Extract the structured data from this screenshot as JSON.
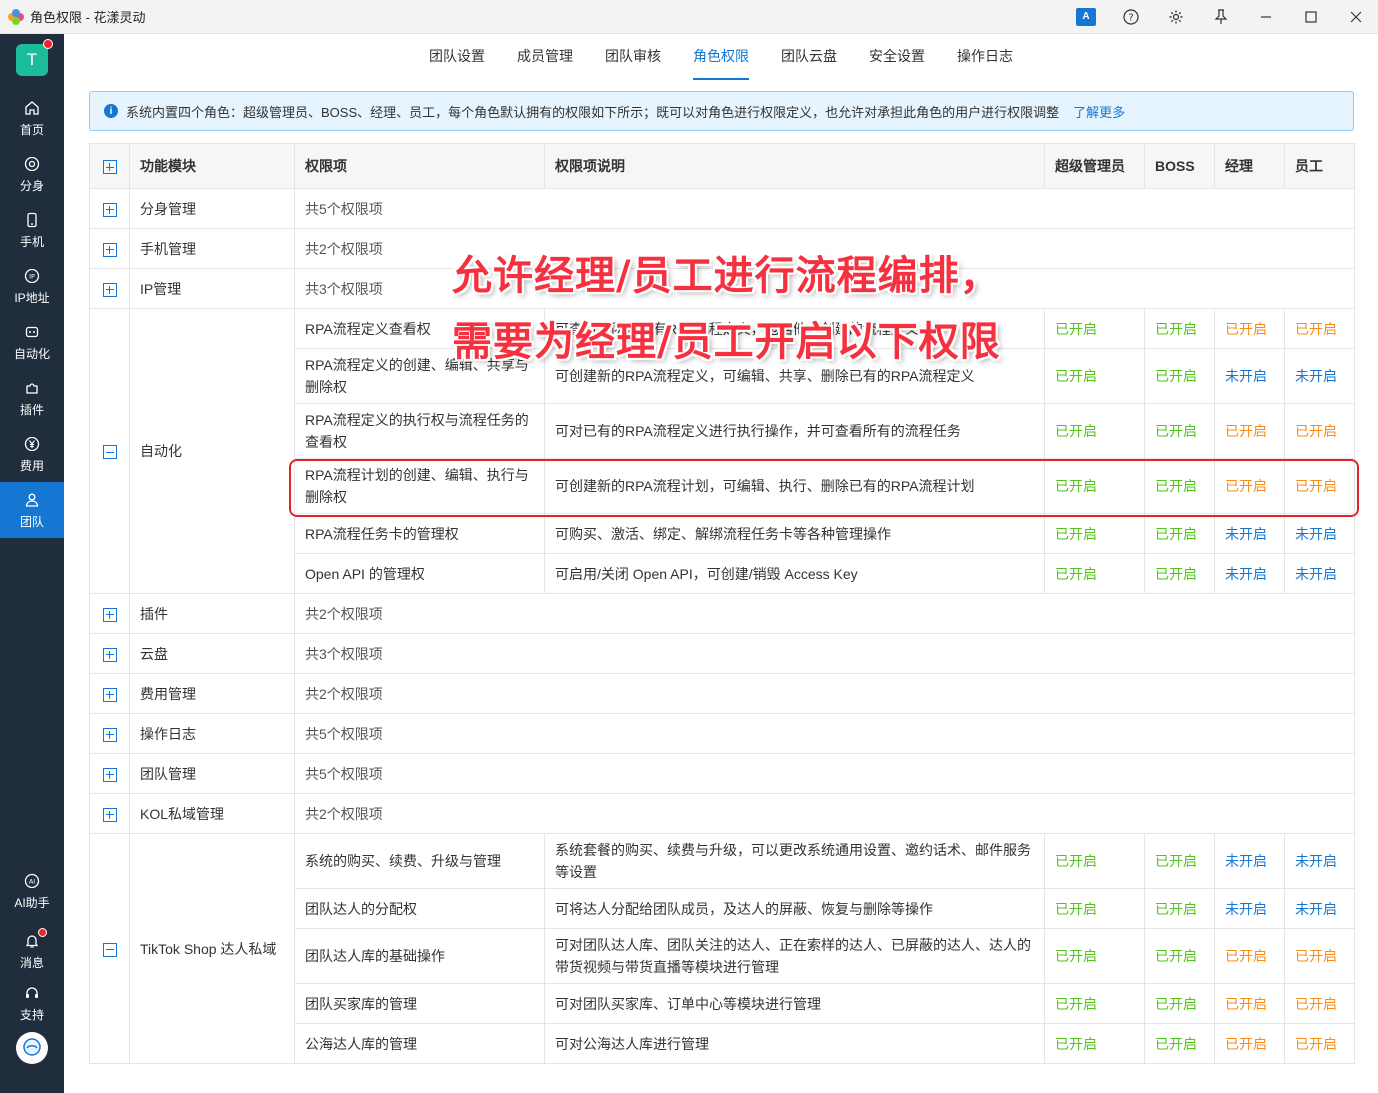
{
  "window": {
    "title": "角色权限 - 花漾灵动",
    "translate_label": "A",
    "help_icon": "help-circle-icon",
    "settings_icon": "gear-icon",
    "pin_icon": "pin-icon",
    "minimize_icon": "minimize-icon",
    "maximize_icon": "maximize-icon",
    "close_icon": "close-icon"
  },
  "sidebar": {
    "avatar_letter": "T",
    "items": [
      {
        "label": "首页",
        "icon": "home-icon"
      },
      {
        "label": "分身",
        "icon": "browser-icon"
      },
      {
        "label": "手机",
        "icon": "phone-icon"
      },
      {
        "label": "IP地址",
        "icon": "ip-icon"
      },
      {
        "label": "自动化",
        "icon": "robot-icon"
      },
      {
        "label": "插件",
        "icon": "puzzle-icon"
      },
      {
        "label": "费用",
        "icon": "yen-icon"
      },
      {
        "label": "团队",
        "icon": "team-icon"
      }
    ],
    "bottom_items": [
      {
        "label": "AI助手",
        "icon": "ai-icon"
      },
      {
        "label": "消息",
        "icon": "bell-icon"
      },
      {
        "label": "支持",
        "icon": "headset-icon"
      }
    ]
  },
  "tabs": [
    "团队设置",
    "成员管理",
    "团队审核",
    "角色权限",
    "团队云盘",
    "安全设置",
    "操作日志"
  ],
  "active_tab": 3,
  "banner": {
    "text": "系统内置四个角色：超级管理员、BOSS、经理、员工，每个角色默认拥有的权限如下所示；既可以对角色进行权限定义，也允许对承担此角色的用户进行权限调整",
    "link": "了解更多"
  },
  "table": {
    "headers": [
      "功能模块",
      "权限项",
      "权限项说明",
      "超级管理员",
      "BOSS",
      "经理",
      "员工"
    ],
    "collapsed_top": [
      {
        "module": "分身管理",
        "summary": "共5个权限项"
      },
      {
        "module": "手机管理",
        "summary": "共2个权限项"
      },
      {
        "module": "IP管理",
        "summary": "共3个权限项"
      }
    ],
    "automation": {
      "module": "自动化",
      "rows": [
        {
          "item": "RPA流程定义查看权",
          "desc": "可查看团队内所有RPA流程定义，包括他人创建的流程定义",
          "s": [
            "已开启",
            "已开启",
            "已开启",
            "已开启"
          ],
          "c": [
            "on",
            "on",
            "warn",
            "warn"
          ]
        },
        {
          "item": "RPA流程定义的创建、编辑、共享与删除权",
          "desc": "可创建新的RPA流程定义，可编辑、共享、删除已有的RPA流程定义",
          "s": [
            "已开启",
            "已开启",
            "未开启",
            "未开启"
          ],
          "c": [
            "on",
            "on",
            "off",
            "off"
          ]
        },
        {
          "item": "RPA流程定义的执行权与流程任务的查看权",
          "desc": "可对已有的RPA流程定义进行执行操作，并可查看所有的流程任务",
          "s": [
            "已开启",
            "已开启",
            "已开启",
            "已开启"
          ],
          "c": [
            "on",
            "on",
            "warn",
            "warn"
          ]
        },
        {
          "item": "RPA流程计划的创建、编辑、执行与删除权",
          "desc": "可创建新的RPA流程计划，可编辑、执行、删除已有的RPA流程计划",
          "s": [
            "已开启",
            "已开启",
            "已开启",
            "已开启"
          ],
          "c": [
            "on",
            "on",
            "warn",
            "warn"
          ]
        },
        {
          "item": "RPA流程任务卡的管理权",
          "desc": "可购买、激活、绑定、解绑流程任务卡等各种管理操作",
          "s": [
            "已开启",
            "已开启",
            "未开启",
            "未开启"
          ],
          "c": [
            "on",
            "on",
            "off",
            "off"
          ]
        },
        {
          "item": "Open API 的管理权",
          "desc": "可启用/关闭 Open API，可创建/销毁 Access Key",
          "s": [
            "已开启",
            "已开启",
            "未开启",
            "未开启"
          ],
          "c": [
            "on",
            "on",
            "off",
            "off"
          ]
        }
      ]
    },
    "collapsed_mid": [
      {
        "module": "插件",
        "summary": "共2个权限项"
      },
      {
        "module": "云盘",
        "summary": "共3个权限项"
      },
      {
        "module": "费用管理",
        "summary": "共2个权限项"
      },
      {
        "module": "操作日志",
        "summary": "共5个权限项"
      },
      {
        "module": "团队管理",
        "summary": "共5个权限项"
      },
      {
        "module": "KOL私域管理",
        "summary": "共2个权限项"
      }
    ],
    "tiktok": {
      "module": "TikTok Shop 达人私域",
      "rows": [
        {
          "item": "系统的购买、续费、升级与管理",
          "desc": "系统套餐的购买、续费与升级，可以更改系统通用设置、邀约话术、邮件服务等设置",
          "s": [
            "已开启",
            "已开启",
            "未开启",
            "未开启"
          ],
          "c": [
            "on",
            "on",
            "off",
            "off"
          ]
        },
        {
          "item": "团队达人的分配权",
          "desc": "可将达人分配给团队成员，及达人的屏蔽、恢复与删除等操作",
          "s": [
            "已开启",
            "已开启",
            "未开启",
            "未开启"
          ],
          "c": [
            "on",
            "on",
            "off",
            "off"
          ]
        },
        {
          "item": "团队达人库的基础操作",
          "desc": "可对团队达人库、团队关注的达人、正在索样的达人、已屏蔽的达人、达人的带货视频与带货直播等模块进行管理",
          "s": [
            "已开启",
            "已开启",
            "已开启",
            "已开启"
          ],
          "c": [
            "on",
            "on",
            "warn",
            "warn"
          ]
        },
        {
          "item": "团队买家库的管理",
          "desc": "可对团队买家库、订单中心等模块进行管理",
          "s": [
            "已开启",
            "已开启",
            "已开启",
            "已开启"
          ],
          "c": [
            "on",
            "on",
            "warn",
            "warn"
          ]
        },
        {
          "item": "公海达人库的管理",
          "desc": "可对公海达人库进行管理",
          "s": [
            "已开启",
            "已开启",
            "已开启",
            "已开启"
          ],
          "c": [
            "on",
            "on",
            "warn",
            "warn"
          ]
        }
      ]
    }
  },
  "annotation": {
    "line1": "允许经理/员工进行流程编排，",
    "line2": "需要为经理/员工开启以下权限"
  },
  "colors": {
    "accent": "#1677d2",
    "enabled": "#52c41a",
    "disabled": "#1677d2",
    "role_enabled": "#fa8c16",
    "annotation": "#f5313f"
  }
}
